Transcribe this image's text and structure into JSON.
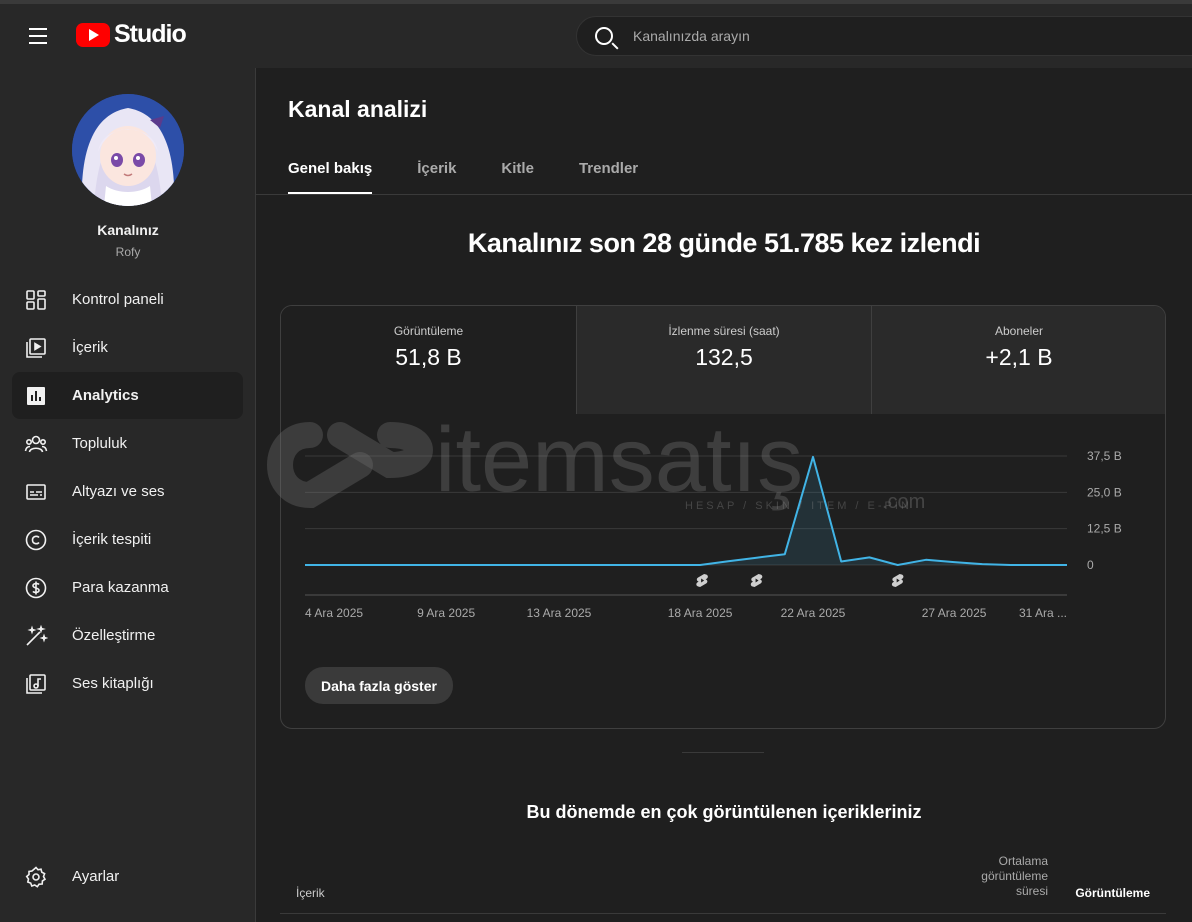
{
  "topbar": {
    "logo_text": "Studio",
    "search_placeholder": "Kanalınızda arayın"
  },
  "sidebar": {
    "channel_name": "Kanalınız",
    "channel_handle": "Rofy",
    "items": [
      {
        "label": "Kontrol paneli",
        "icon": "dashboard-icon"
      },
      {
        "label": "İçerik",
        "icon": "content-icon"
      },
      {
        "label": "Analytics",
        "icon": "analytics-icon",
        "active": true
      },
      {
        "label": "Topluluk",
        "icon": "community-icon"
      },
      {
        "label": "Altyazı ve ses",
        "icon": "subtitles-icon"
      },
      {
        "label": "İçerik tespiti",
        "icon": "copyright-icon"
      },
      {
        "label": "Para kazanma",
        "icon": "monetization-icon"
      },
      {
        "label": "Özelleştirme",
        "icon": "customization-icon"
      },
      {
        "label": "Ses kitaplığı",
        "icon": "audio-library-icon"
      }
    ],
    "settings_label": "Ayarlar"
  },
  "main": {
    "title": "Kanal analizi",
    "tabs": [
      {
        "label": "Genel bakış",
        "active": true
      },
      {
        "label": "İçerik"
      },
      {
        "label": "Kitle"
      },
      {
        "label": "Trendler"
      }
    ],
    "headline": "Kanalınız son 28 günde 51.785 kez izlendi",
    "metrics": [
      {
        "label": "Görüntüleme",
        "value": "51,8 B"
      },
      {
        "label": "İzlenme süresi (saat)",
        "value": "132,5"
      },
      {
        "label": "Aboneler",
        "value": "+2,1 B"
      }
    ],
    "show_more": "Daha fazla göster",
    "top_content_title": "Bu dönemde en çok görüntülenen içerikleriniz",
    "table_headers": {
      "content": "İçerik",
      "avg_duration": "Ortalama görüntüleme süresi",
      "views": "Görüntüleme"
    }
  },
  "watermark": {
    "text": "itemsatış",
    "tagline": "HESAP / SKIN / ITEM / E-PIN",
    "suffix": ".com"
  },
  "colors": {
    "accent_line": "#41b4e6",
    "youtube_red": "#ff0000",
    "background": "#1f1f1f",
    "panel": "#282828"
  },
  "chart_data": {
    "type": "line",
    "title": "",
    "xlabel": "",
    "ylabel": "",
    "x_ticks": [
      "4 Ara 2025",
      "9 Ara 2025",
      "13 Ara 2025",
      "18 Ara 2025",
      "22 Ara 2025",
      "27 Ara 2025",
      "31 Ara ..."
    ],
    "y_ticks": [
      "37,5 B",
      "25,0 B",
      "12,5 B",
      "0"
    ],
    "ylim": [
      0,
      37500
    ],
    "x": [
      "4 Ara 2025",
      "5 Ara 2025",
      "6 Ara 2025",
      "7 Ara 2025",
      "8 Ara 2025",
      "9 Ara 2025",
      "10 Ara 2025",
      "11 Ara 2025",
      "12 Ara 2025",
      "13 Ara 2025",
      "14 Ara 2025",
      "15 Ara 2025",
      "16 Ara 2025",
      "17 Ara 2025",
      "18 Ara 2025",
      "19 Ara 2025",
      "20 Ara 2025",
      "21 Ara 2025",
      "22 Ara 2025",
      "23 Ara 2025",
      "24 Ara 2025",
      "25 Ara 2025",
      "26 Ara 2025",
      "27 Ara 2025",
      "28 Ara 2025",
      "29 Ara 2025",
      "30 Ara 2025",
      "31 Ara 2025"
    ],
    "values": [
      0,
      0,
      0,
      0,
      0,
      0,
      0,
      0,
      0,
      0,
      0,
      0,
      0,
      0,
      0,
      1300,
      2500,
      3700,
      37200,
      1200,
      2600,
      0,
      1800,
      1000,
      300,
      0,
      0,
      0
    ],
    "shorts_markers": [
      "18 Ara 2025",
      "20 Ara 2025",
      "25 Ara 2025"
    ],
    "grid": true
  }
}
